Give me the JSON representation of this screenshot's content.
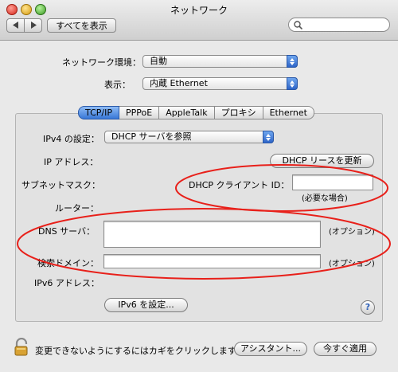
{
  "window": {
    "title": "ネットワーク"
  },
  "toolbar": {
    "show_all_label": "すべてを表示",
    "search_placeholder": ""
  },
  "location": {
    "label": "ネットワーク環境：",
    "value": "自動"
  },
  "show": {
    "label": "表示：",
    "value": "内蔵 Ethernet"
  },
  "tabs": [
    {
      "label": "TCP/IP",
      "active": true
    },
    {
      "label": "PPPoE",
      "active": false
    },
    {
      "label": "AppleTalk",
      "active": false
    },
    {
      "label": "プロキシ",
      "active": false
    },
    {
      "label": "Ethernet",
      "active": false
    }
  ],
  "tcpip": {
    "ipv4_label": "IPv4 の設定：",
    "ipv4_value": "DHCP サーバを参照",
    "ip_label": "IP アドレス：",
    "renew_button": "DHCP リースを更新",
    "subnet_label": "サブネットマスク：",
    "client_id_label": "DHCP クライアント ID：",
    "client_id_value": "",
    "client_id_note": "(必要な場合)",
    "router_label": "ルーター：",
    "dns_label": "DNS サーバ：",
    "dns_value": "",
    "dns_note": "(オプション)",
    "search_domains_label": "検索ドメイン：",
    "search_domains_value": "",
    "search_domains_note": "(オプション)",
    "ipv6_label": "IPv6 アドレス：",
    "ipv6_button": "IPv6 を設定...",
    "help_label": "?"
  },
  "footer": {
    "lock_text": "変更できないようにするにはカギをクリックします。",
    "assistant_button": "アシスタント...",
    "apply_button": "今すぐ適用"
  },
  "colors": {
    "accent": "#3777d7",
    "annotation": "#e8201a"
  }
}
